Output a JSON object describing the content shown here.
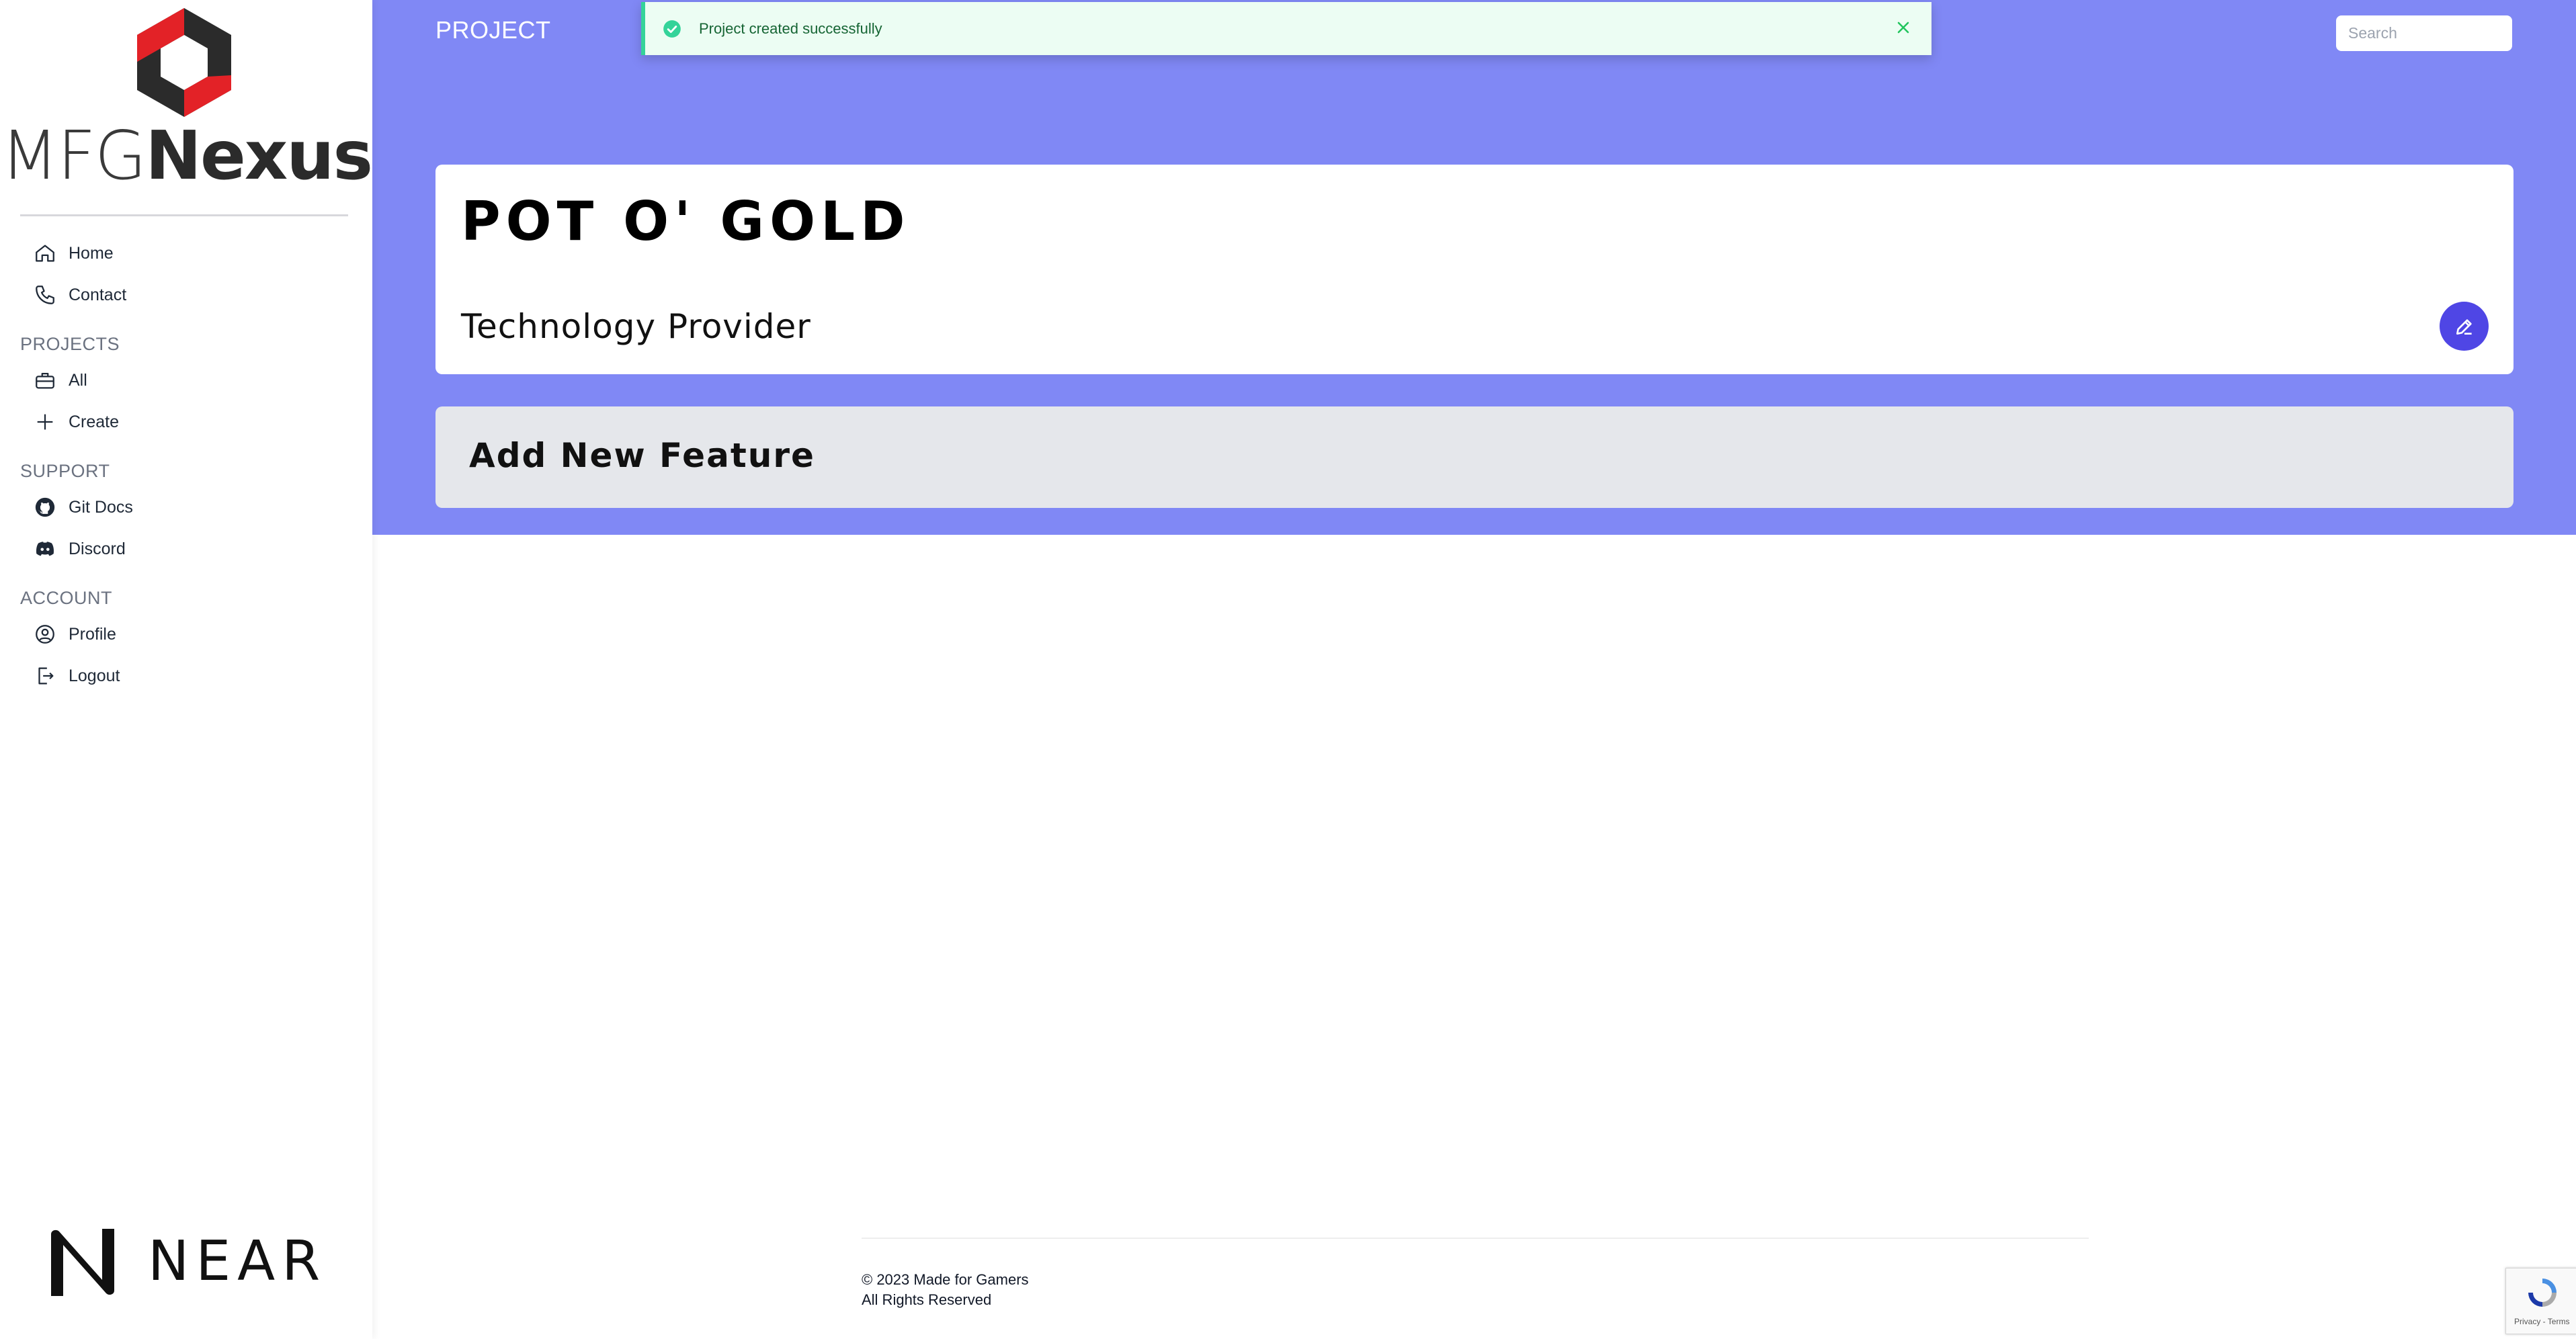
{
  "brand": {
    "logo_thin": "MFG",
    "logo_bold": "Nexus",
    "accent": "#e32227",
    "dark": "#2b2b2b"
  },
  "sidebar": {
    "top_items": [
      {
        "label": "Home",
        "icon": "home-icon"
      },
      {
        "label": "Contact",
        "icon": "phone-icon"
      }
    ],
    "sections": [
      {
        "title": "PROJECTS",
        "items": [
          {
            "label": "All",
            "icon": "briefcase-icon"
          },
          {
            "label": "Create",
            "icon": "plus-icon"
          }
        ]
      },
      {
        "title": "SUPPORT",
        "items": [
          {
            "label": "Git Docs",
            "icon": "github-icon"
          },
          {
            "label": "Discord",
            "icon": "discord-icon"
          }
        ]
      },
      {
        "title": "ACCOUNT",
        "items": [
          {
            "label": "Profile",
            "icon": "user-circle-icon"
          },
          {
            "label": "Logout",
            "icon": "logout-icon"
          }
        ]
      }
    ],
    "partner_logo": "NEAR"
  },
  "header": {
    "title": "PROJECT",
    "search_placeholder": "Search",
    "banner_color": "#8088f5"
  },
  "toast": {
    "message": "Project created successfully",
    "icon": "check-circle-icon",
    "close_icon": "close-icon"
  },
  "project": {
    "title": "POT O' GOLD",
    "category": "Technology Provider",
    "edit_icon": "pencil-icon",
    "edit_color": "#4f46e5"
  },
  "feature": {
    "label": "Add New Feature"
  },
  "footer": {
    "copyright": "© 2023 Made for Gamers",
    "rights": "All Rights Reserved"
  },
  "recaptcha": {
    "links": "Privacy - Terms"
  }
}
